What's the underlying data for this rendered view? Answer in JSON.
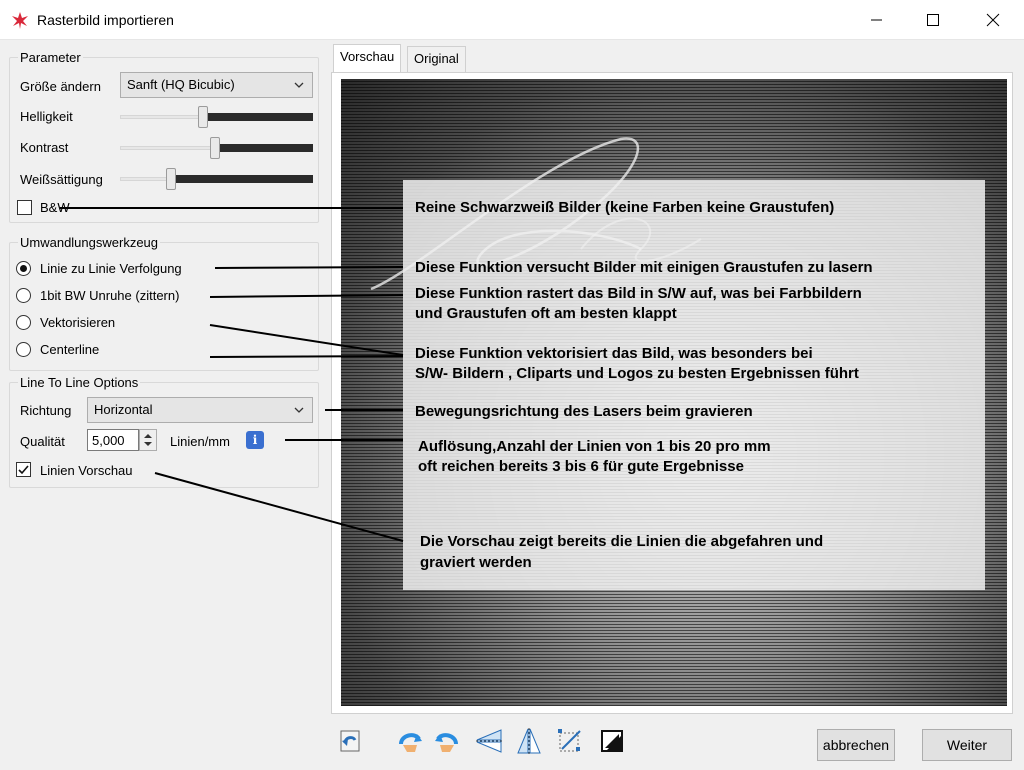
{
  "window": {
    "title": "Rasterbild importieren"
  },
  "parameter": {
    "group_label": "Parameter",
    "resize_label": "Größe ändern",
    "resize_value": "Sanft (HQ Bicubic)",
    "brightness_label": "Helligkeit",
    "brightness_level": 0.43,
    "contrast_label": "Kontrast",
    "contrast_level": 0.49,
    "whiteness_label": "Weißsättigung",
    "whiteness_level": 0.26,
    "bw_label": "B&W",
    "bw_checked": false
  },
  "conversion": {
    "group_label": "Umwandlungswerkzeug",
    "options": [
      {
        "label": "Linie zu Linie Verfolgung",
        "selected": true
      },
      {
        "label": "1bit BW Unruhe (zittern)",
        "selected": false
      },
      {
        "label": "Vektorisieren",
        "selected": false
      },
      {
        "label": "Centerline",
        "selected": false
      }
    ]
  },
  "line_options": {
    "group_label": "Line To Line Options",
    "direction_label": "Richtung",
    "direction_value": "Horizontal",
    "quality_label": "Qualität",
    "quality_value": "5,000",
    "unit_label": "Linien/mm",
    "preview_label": "Linien Vorschau",
    "preview_checked": true
  },
  "tabs": [
    {
      "label": "Vorschau",
      "active": true
    },
    {
      "label": "Original",
      "active": false
    }
  ],
  "annotations": {
    "bw": "Reine Schwarzweiß Bilder (keine Farben keine Graustufen)",
    "line_to_line": "Diese Funktion versucht Bilder mit einigen Graustufen zu lasern",
    "dither_1": "Diese Funktion rastert das Bild in S/W auf, was bei Farbbildern",
    "dither_2": "und Graustufen oft am besten klappt",
    "vector_1": "Diese Funktion vektorisiert das Bild, was besonders bei",
    "vector_2": "S/W- Bildern , Cliparts und Logos zu besten Ergebnissen führt",
    "direction": "Bewegungsrichtung des Lasers beim gravieren",
    "resolution_1": "Auflösung,Anzahl der Linien von 1 bis 20 pro mm",
    "resolution_2": "oft reichen bereits 3 bis 6 für gute Ergebnisse",
    "preview_1": "Die Vorschau zeigt bereits die Linien die abgefahren und",
    "preview_2": "graviert werden"
  },
  "toolbar_icons": [
    "reset-icon",
    "rotate-left-icon",
    "rotate-right-icon",
    "flip-horizontal-icon",
    "flip-vertical-icon",
    "crop-icon",
    "invert-icon"
  ],
  "buttons": {
    "cancel": "abbrechen",
    "next": "Weiter"
  },
  "colors": {
    "info_blue": "#3a6fd0",
    "title_bar": "#ffffff",
    "window_bg": "#f0f0f0"
  }
}
